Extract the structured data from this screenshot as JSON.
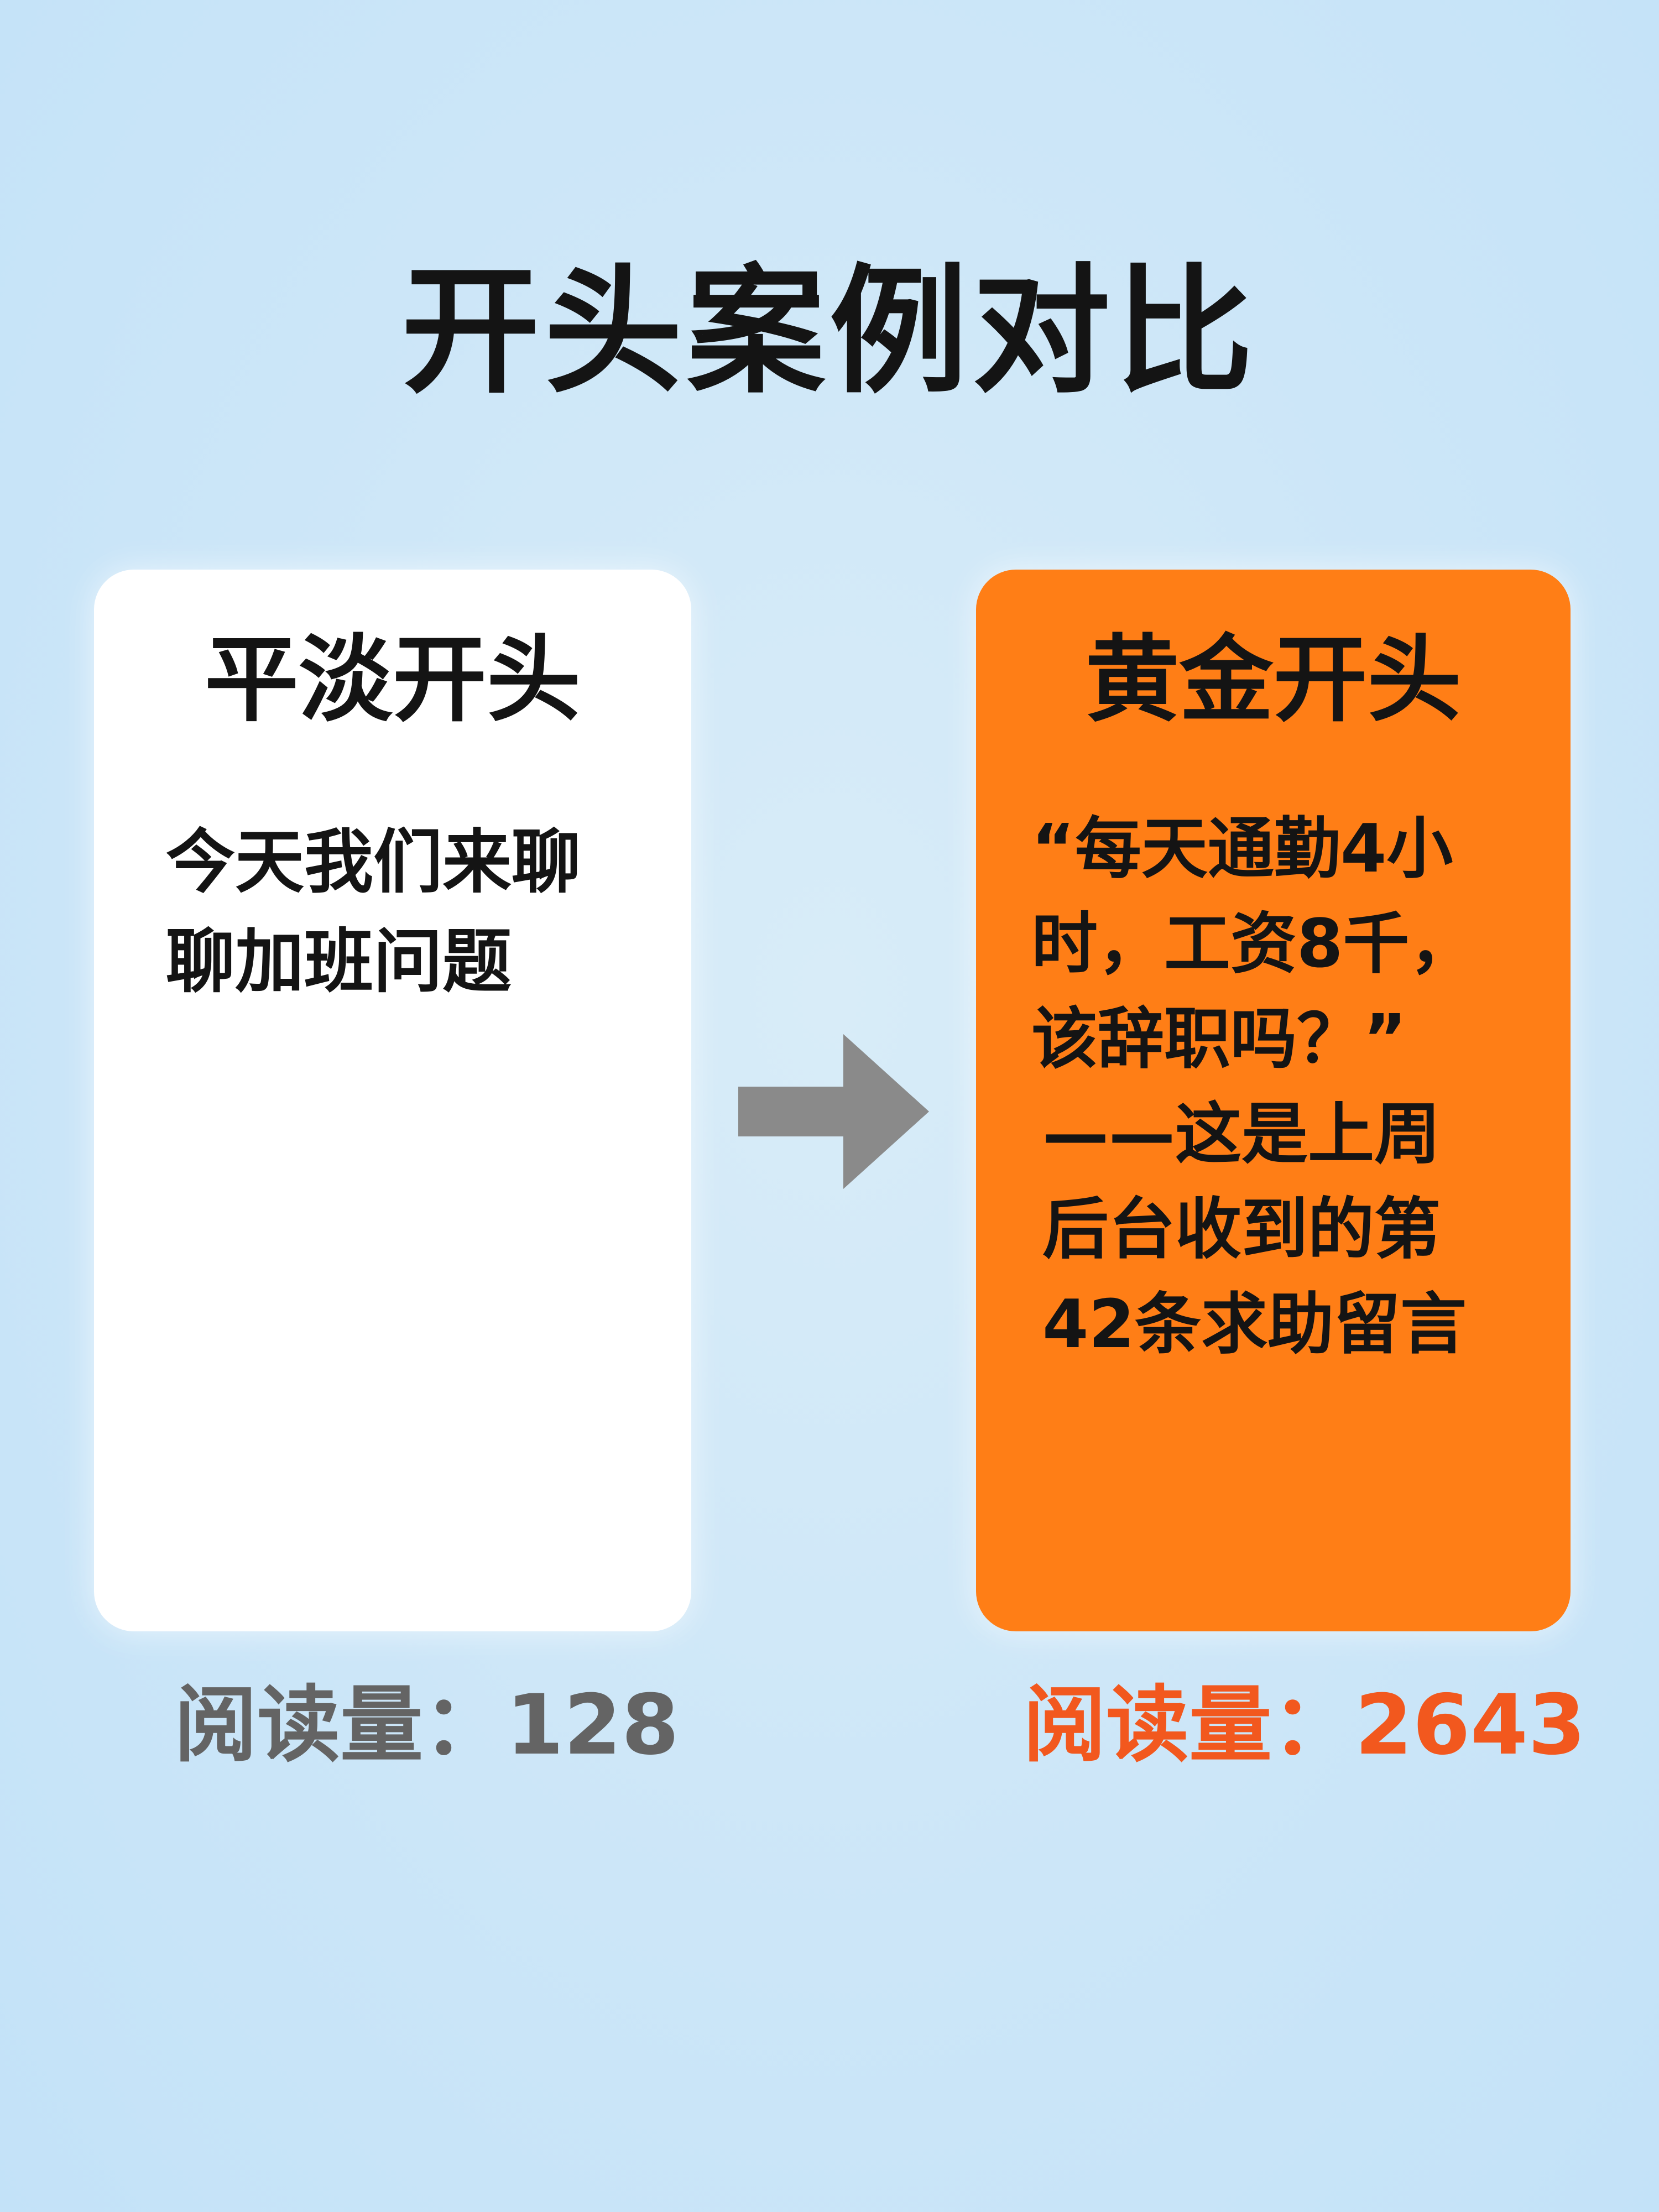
{
  "title": "开头案例对比",
  "plain_card": {
    "heading": "平淡开头",
    "body_lines": [
      "今天我们来聊",
      "聊加班问题"
    ],
    "read_label": "阅读量：",
    "read_value": "128"
  },
  "gold_card": {
    "heading": "黄金开头",
    "body_lines": [
      "“每天通勤4小",
      "时，工资8千，",
      "该辞职吗？”",
      "——这是上周",
      "后台收到的第",
      "42条求助留言"
    ],
    "read_label": "阅读量：",
    "read_value": "2643"
  },
  "arrow_icon": "arrow-right-icon",
  "colors": {
    "background": "#cce6f8",
    "gold_card": "#ff7e16",
    "plain_card": "#ffffff",
    "plain_stat": "#646464",
    "gold_stat": "#f2581e",
    "arrow": "#8a8a8a"
  }
}
